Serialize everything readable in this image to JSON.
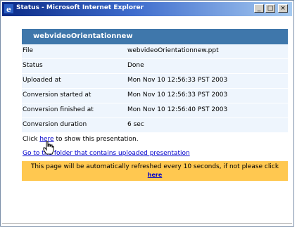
{
  "window": {
    "title": "Status - Microsoft Internet Explorer"
  },
  "controls": {
    "minimize": "_",
    "maximize": "□",
    "close": "×"
  },
  "panel": {
    "heading": "webvideoOrientationnew",
    "rows": [
      {
        "label": "File",
        "value": "webvideoOrientationnew.ppt"
      },
      {
        "label": "Status",
        "value": "Done"
      },
      {
        "label": "Uploaded at",
        "value": "Mon Nov 10 12:56:33 PST 2003"
      },
      {
        "label": "Conversion started at",
        "value": "Mon Nov 10 12:56:33 PST 2003"
      },
      {
        "label": "Conversion finished at",
        "value": "Mon Nov 10 12:56:40 PST 2003"
      },
      {
        "label": "Conversion duration",
        "value": "6 sec"
      }
    ],
    "click_prefix": "Click ",
    "click_link": "here",
    "click_suffix": " to show this presentation.",
    "folder_link": "Go to the folder that contains uploaded presentation",
    "notice_text": "This page will be automatically refreshed every 10 seconds, if not please click ",
    "notice_link": "here"
  },
  "colors": {
    "header": "#3f77ab",
    "row": "#eef5fd",
    "notice": "#ffc850",
    "link": "#0000cc"
  },
  "icons": {
    "app": "ie-icon",
    "cursor": "hand-cursor-icon"
  }
}
